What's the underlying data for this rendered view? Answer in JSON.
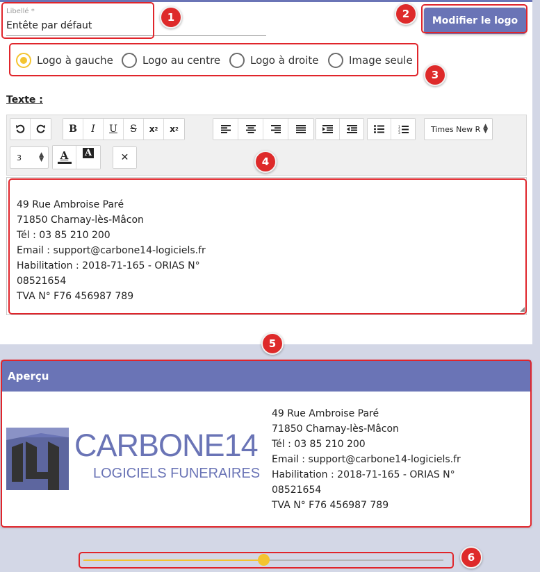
{
  "form": {
    "libelle_label": "Libellé *",
    "libelle_value": "Entête par défaut",
    "logo_button": "Modifier le logo",
    "texte_label": "Texte :"
  },
  "layout_options": [
    {
      "label": "Logo à gauche",
      "checked": true
    },
    {
      "label": "Logo au centre",
      "checked": false
    },
    {
      "label": "Logo à droite",
      "checked": false
    },
    {
      "label": "Image seule",
      "checked": false
    }
  ],
  "toolbar": {
    "font_family": "Times New R",
    "font_size": "3",
    "buttons": [
      "undo-icon",
      "redo-icon",
      "bold-icon",
      "italic-icon",
      "underline-icon",
      "strikethrough-icon",
      "subscript-icon",
      "superscript-icon",
      "align-left-icon",
      "align-center-icon",
      "align-right-icon",
      "justify-icon",
      "indent-icon",
      "outdent-icon",
      "bullet-list-icon",
      "numbered-list-icon",
      "text-color-icon",
      "background-color-icon",
      "clear-format-icon"
    ]
  },
  "editor": {
    "lines": [
      "49 Rue Ambroise Paré",
      "71850 Charnay-lès-Mâcon",
      "Tél : 03 85 210 200",
      "Email : support@carbone14-logiciels.fr",
      "Habilitation : 2018-71-165 - ORIAS N°",
      "08521654",
      "TVA N° F76 456987 789"
    ]
  },
  "preview": {
    "title": "Aperçu",
    "logo_name": "CARBONE14",
    "logo_subtitle": "LOGICIELS FUNERAIRES",
    "lines": [
      "49 Rue Ambroise Paré",
      "71850 Charnay-lès-Mâcon",
      "Tél : 03 85 210 200",
      "Email : support@carbone14-logiciels.fr",
      "Habilitation : 2018-71-165 - ORIAS N°",
      "08521654",
      "TVA N° F76 456987 789"
    ]
  },
  "slider": {
    "value_fraction": 0.5
  },
  "markers": [
    "1",
    "2",
    "3",
    "4",
    "5",
    "6"
  ],
  "colors": {
    "accent": "#6a74b6",
    "radio_selected": "#f4c430",
    "annotation": "#e0252b",
    "logo_blue": "#6a74b6",
    "logo_dark": "#333333"
  }
}
